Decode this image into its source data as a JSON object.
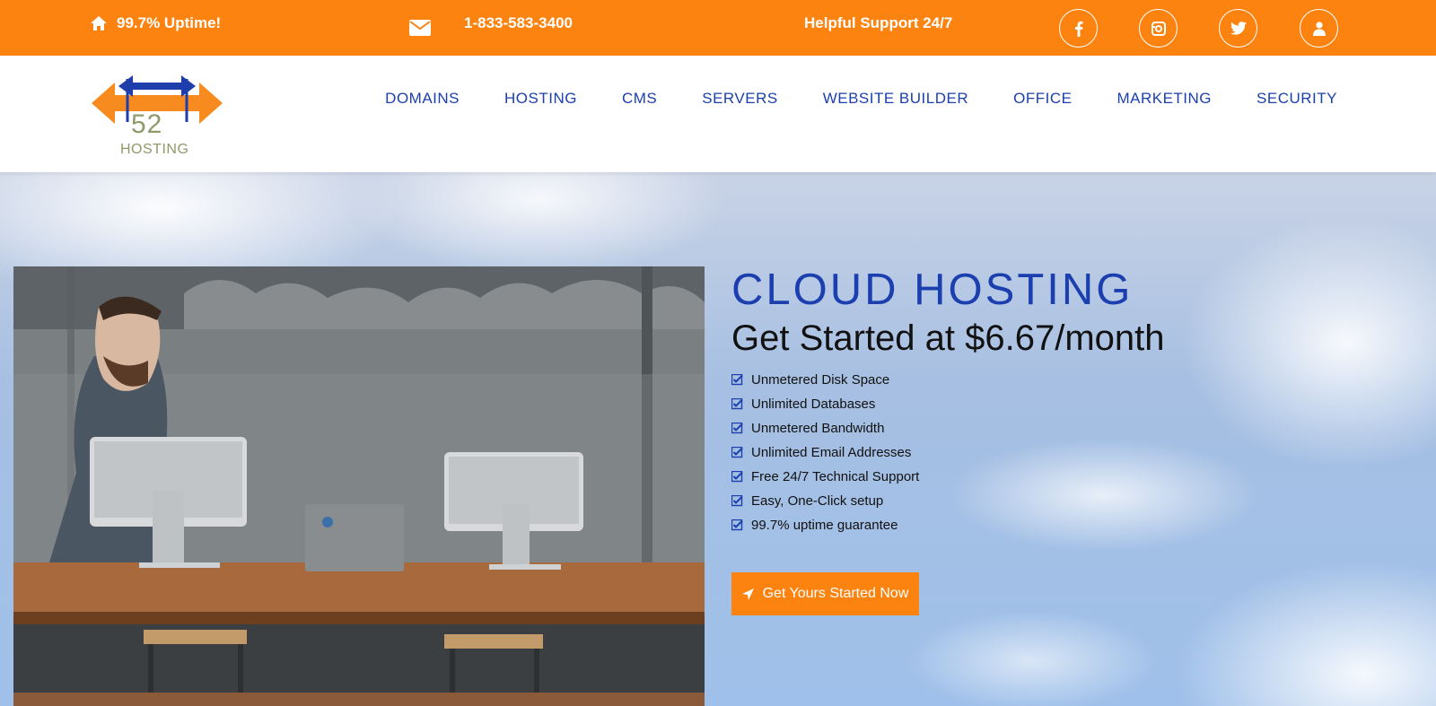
{
  "topbar": {
    "uptime": "99.7% Uptime!",
    "phone": "1-833-583-3400",
    "support": "Helpful Support 24/7",
    "social": [
      "facebook-icon",
      "instagram-icon",
      "twitter-icon",
      "user-icon"
    ]
  },
  "logo": {
    "number": "52",
    "word": "HOSTING"
  },
  "nav": [
    "DOMAINS",
    "HOSTING",
    "CMS",
    "SERVERS",
    "WEBSITE BUILDER",
    "OFFICE",
    "MARKETING",
    "SECURITY"
  ],
  "hero": {
    "title": "CLOUD HOSTING",
    "subtitle": "Get Started at $6.67/month",
    "features": [
      "Unmetered Disk Space",
      "Unlimited Databases",
      "Unmetered Bandwidth",
      "Unlimited Email Addresses",
      "Free 24/7 Technical Support",
      "Easy, One-Click setup",
      "99.7% uptime guarantee"
    ],
    "cta": "Get Yours Started Now"
  },
  "colors": {
    "accent": "#fd8310",
    "brand_blue": "#1b3fae"
  }
}
